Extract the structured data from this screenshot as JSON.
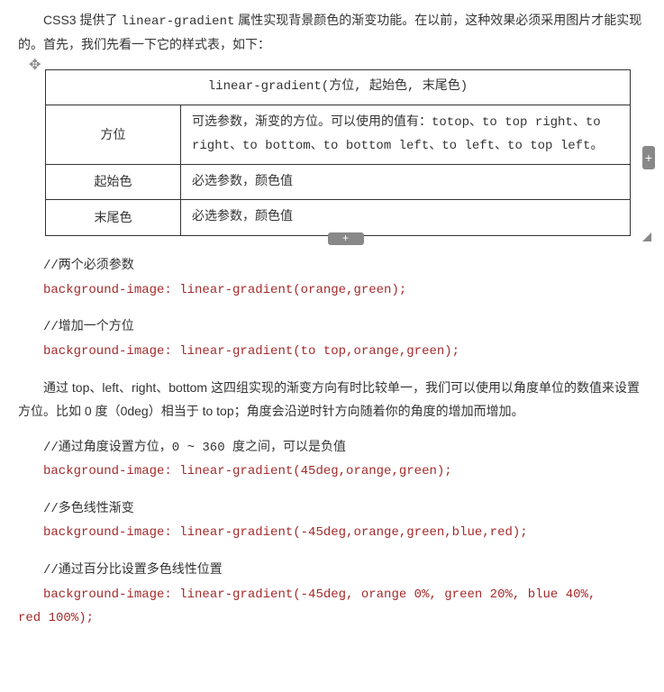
{
  "intro": {
    "prefix": "CSS3 提供了 ",
    "code": "linear-gradient",
    "suffix": " 属性实现背景颜色的渐变功能。在以前，这种效果必须采用图片才能实现的。首先，我们先看一下它的样式表，如下："
  },
  "table": {
    "header": "linear-gradient(方位, 起始色, 末尾色)",
    "rows": [
      {
        "label": "方位",
        "desc": "可选参数，渐变的方位。可以使用的值有：totop、to top right、to right、to bottom、to bottom left、to left、to top left。"
      },
      {
        "label": "起始色",
        "desc": "必选参数，颜色值"
      },
      {
        "label": "末尾色",
        "desc": "必选参数，颜色值"
      }
    ]
  },
  "block1": {
    "comment": "//两个必须参数",
    "code": "background-image: linear-gradient(orange,green);"
  },
  "block2": {
    "comment": "//增加一个方位",
    "code": "background-image: linear-gradient(to top,orange,green);"
  },
  "para1": "通过 top、left、right、bottom 这四组实现的渐变方向有时比较单一，我们可以使用以角度单位的数值来设置方位。比如 0 度（0deg）相当于 to top；角度会沿逆时针方向随着你的角度的增加而增加。",
  "block3": {
    "comment": "//通过角度设置方位，0 ~ 360 度之间，可以是负值",
    "code": "background-image: linear-gradient(45deg,orange,green);"
  },
  "block4": {
    "comment": "//多色线性渐变",
    "code": "background-image: linear-gradient(-45deg,orange,green,blue,red);"
  },
  "block5": {
    "comment": "//通过百分比设置多色线性位置",
    "code_l1": "background-image: linear-gradient(-45deg, orange 0%, green 20%, blue 40%,",
    "code_l2": "red 100%);"
  }
}
